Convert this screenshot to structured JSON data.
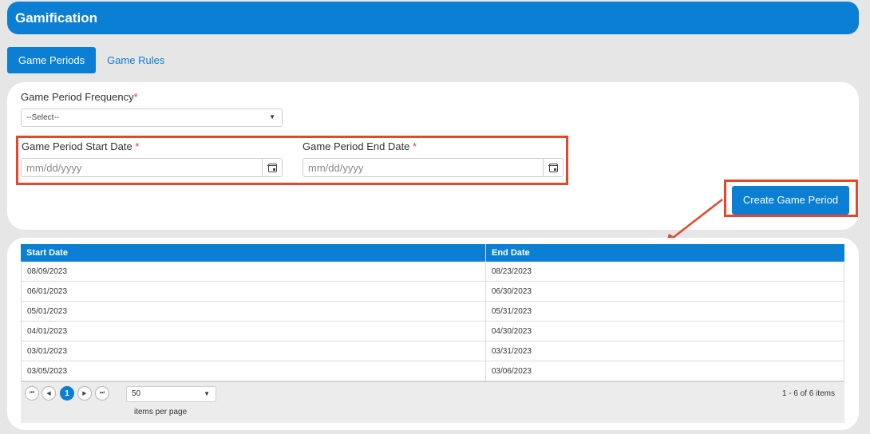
{
  "header": {
    "title": "Gamification"
  },
  "tabs": [
    {
      "label": "Game Periods",
      "active": true
    },
    {
      "label": "Game Rules",
      "active": false
    }
  ],
  "form": {
    "frequency_label": "Game Period Frequency",
    "required_mark": "*",
    "frequency_value": "--Select--",
    "start_label": "Game Period Start Date ",
    "end_label": "Game Period End Date ",
    "start_placeholder": "mm/dd/yyyy",
    "end_placeholder": "mm/dd/yyyy",
    "create_button": "Create Game Period"
  },
  "grid": {
    "columns": [
      "Start Date",
      "End Date"
    ],
    "rows": [
      [
        "08/09/2023",
        "08/23/2023"
      ],
      [
        "06/01/2023",
        "06/30/2023"
      ],
      [
        "05/01/2023",
        "05/31/2023"
      ],
      [
        "04/01/2023",
        "04/30/2023"
      ],
      [
        "03/01/2023",
        "03/31/2023"
      ],
      [
        "03/05/2023",
        "03/06/2023"
      ]
    ]
  },
  "pager": {
    "first": "⏮",
    "prev": "◀",
    "current_page": "1",
    "next": "▶",
    "last": "⏭",
    "page_size": "50",
    "items_per_page": "items per page",
    "info": "1 - 6 of 6 items"
  },
  "colors": {
    "accent": "#0a7fd4",
    "highlight": "#e8452b",
    "required": "#e53935"
  }
}
